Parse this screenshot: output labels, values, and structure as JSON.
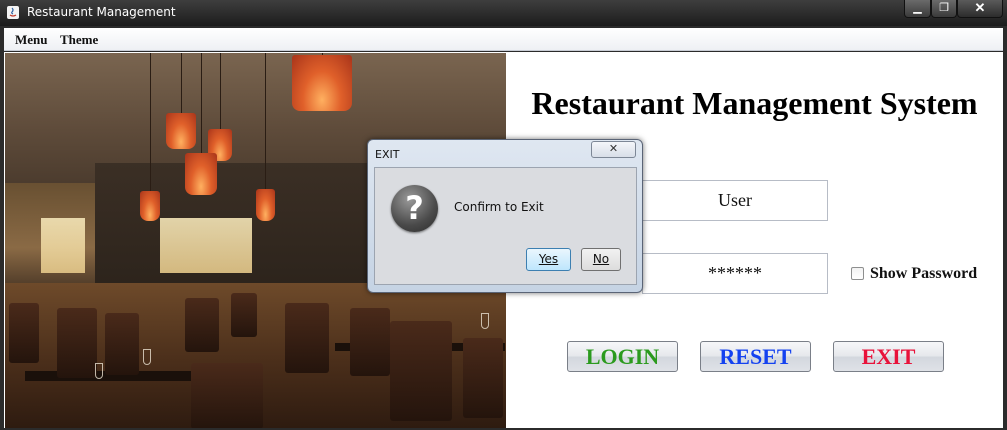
{
  "window": {
    "title": "Restaurant Management",
    "min_glyph": "▁",
    "max_glyph": "❐",
    "close_glyph": "✕"
  },
  "menubar": {
    "items": [
      {
        "label": "Menu"
      },
      {
        "label": "Theme"
      }
    ]
  },
  "main": {
    "title": "Restaurant Management System",
    "username_value": "User",
    "password_value": "******",
    "show_password_label": "Show Password",
    "show_password_checked": false,
    "buttons": {
      "login": "LOGIN",
      "reset": "RESET",
      "exit": "EXIT"
    },
    "button_colors": {
      "login": "#2b9a1e",
      "reset": "#1442f0",
      "exit": "#e8123a"
    }
  },
  "dialog": {
    "title": "EXIT",
    "close_glyph": "✕",
    "icon": "question-icon",
    "icon_glyph": "?",
    "message": "Confirm to Exit",
    "yes_label": "Yes",
    "no_label": "No"
  }
}
